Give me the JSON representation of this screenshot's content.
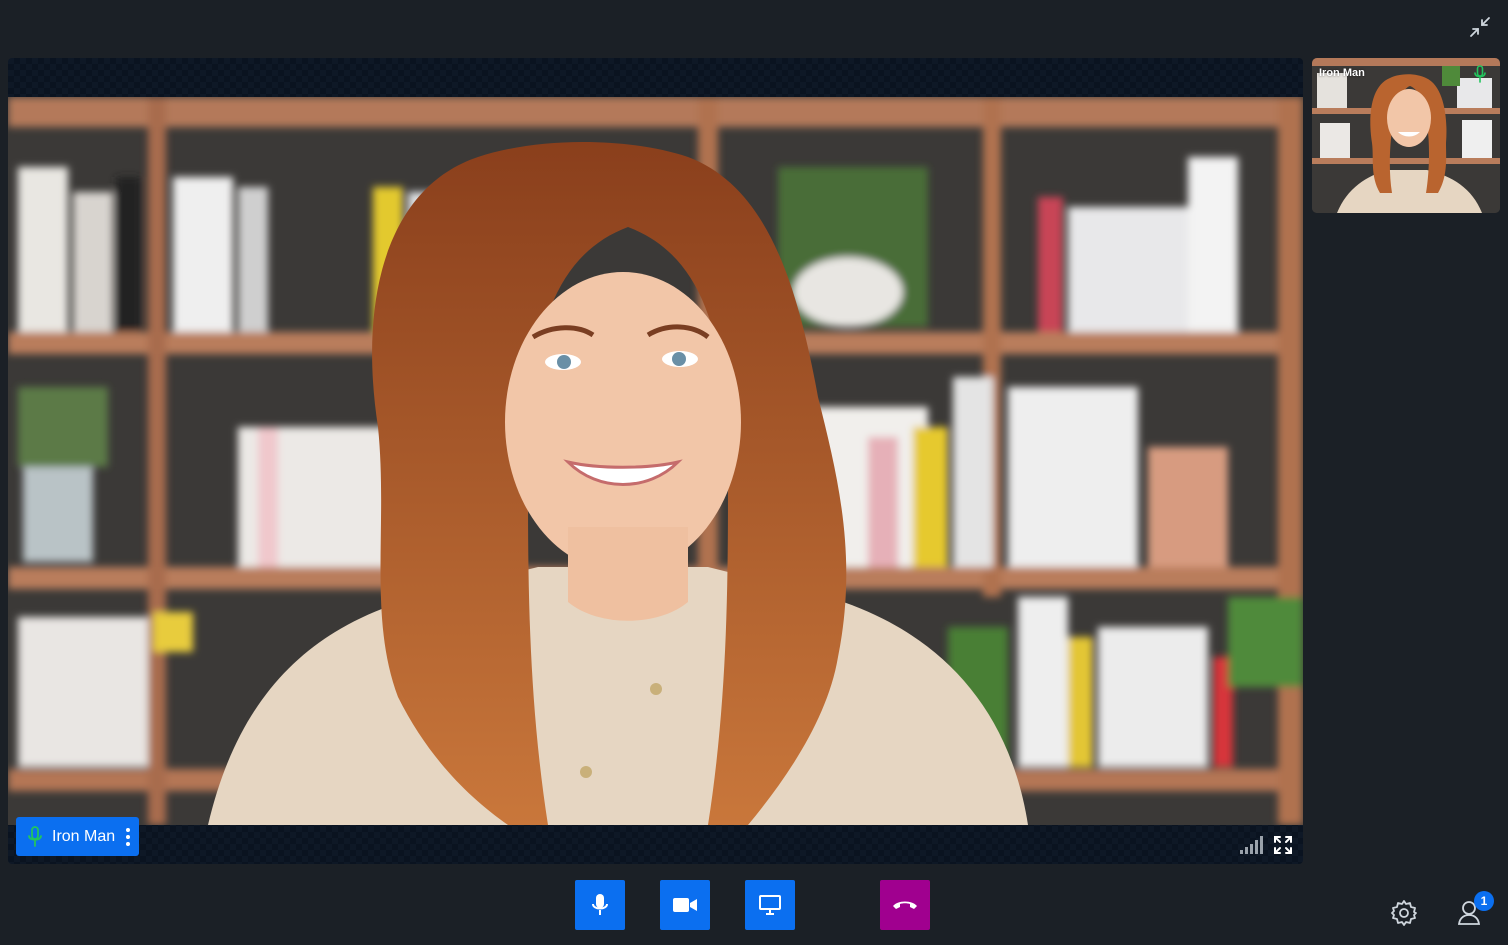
{
  "main": {
    "participant_name": "Iron Man"
  },
  "thumbnail": {
    "participant_name": "Iron Man"
  },
  "controls": {
    "participants_count": "1"
  },
  "colors": {
    "accent": "#0b6ff0",
    "end_call": "#a0008f",
    "background": "#1b2026",
    "mic_active": "#22c55e"
  },
  "icons": [
    "collapse-icon",
    "microphone-icon",
    "kebab-menu-icon",
    "signal-strength-icon",
    "fullscreen-icon",
    "video-camera-icon",
    "screen-share-icon",
    "hang-up-icon",
    "gear-icon",
    "participants-icon"
  ]
}
